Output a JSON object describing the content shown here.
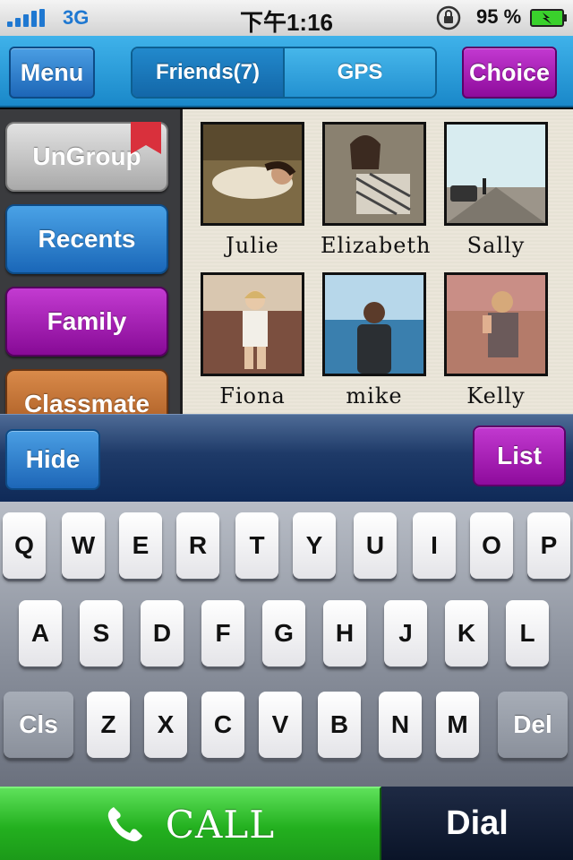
{
  "status_bar": {
    "carrier": "3G",
    "time": "下午1:16",
    "battery_percent": "95 %",
    "icons": [
      "signal-icon",
      "orientation-lock-icon",
      "battery-charging-icon"
    ]
  },
  "nav": {
    "menu_label": "Menu",
    "choice_label": "Choice",
    "segments": [
      {
        "label": "Friends(7)",
        "selected": true
      },
      {
        "label": "GPS",
        "selected": false
      }
    ]
  },
  "sidebar": {
    "groups": [
      {
        "label": "UnGroup",
        "color": "#b5b5b5",
        "bookmark": true
      },
      {
        "label": "Recents",
        "color": "#2e7fd0"
      },
      {
        "label": "Family",
        "color": "#a61ab5"
      },
      {
        "label": "Classmate",
        "color": "#c07033"
      }
    ]
  },
  "friends": [
    {
      "name": "Julie"
    },
    {
      "name": "Elizabeth"
    },
    {
      "name": "Sally"
    },
    {
      "name": "Fiona"
    },
    {
      "name": "mike"
    },
    {
      "name": "Kelly"
    }
  ],
  "action_bar": {
    "hide_label": "Hide",
    "list_label": "List"
  },
  "keyboard": {
    "row1": [
      "Q",
      "W",
      "E",
      "R",
      "T",
      "Y",
      "U",
      "I",
      "O",
      "P"
    ],
    "row2": [
      "A",
      "S",
      "D",
      "F",
      "G",
      "H",
      "J",
      "K",
      "L"
    ],
    "row3": [
      "Z",
      "X",
      "C",
      "V",
      "B",
      "N",
      "M"
    ],
    "clear_label": "Cls",
    "delete_label": "Del"
  },
  "bottom": {
    "call_label": "CALL",
    "dial_label": "Dial"
  },
  "colors": {
    "nav_blue": "#2a9ad8",
    "accent_purple": "#a61ab5",
    "call_green": "#2fbf2a",
    "dial_navy": "#0f1a30"
  }
}
